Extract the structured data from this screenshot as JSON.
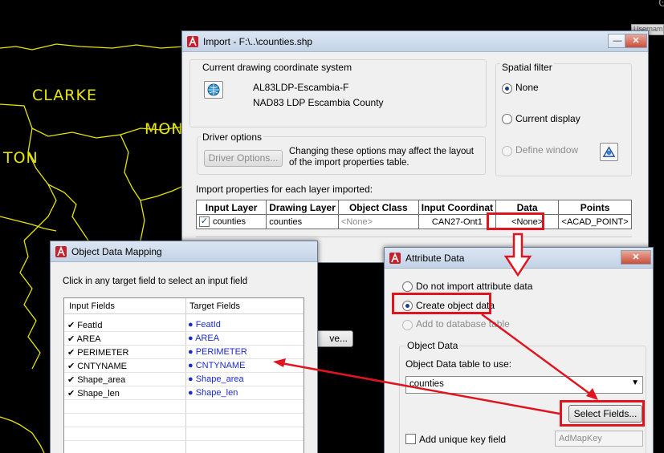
{
  "cad": {
    "labels": [
      "CLARKE",
      "MON",
      "TON"
    ],
    "corner_button": "Username"
  },
  "import_dialog": {
    "title": "Import - F:\\..\\counties.shp",
    "coord_group_label": "Current drawing coordinate system",
    "coord_code": "AL83LDP-Escambia-F",
    "coord_name": "NAD83 LDP Escambia County",
    "driver_group_label": "Driver options",
    "driver_button": "Driver Options...",
    "driver_note_line1": "Changing these options may affect the layout",
    "driver_note_line2": "of the import properties table.",
    "spatial_group_label": "Spatial filter",
    "spatial_none": "None",
    "spatial_current": "Current display",
    "spatial_window": "Define window",
    "import_props_label": "Import properties for each layer imported:",
    "columns": [
      "Input Layer",
      "Drawing Layer",
      "Object Class",
      "Input Coordinat",
      "Data",
      "Points"
    ],
    "row": {
      "input_layer": "counties",
      "drawing_layer": "counties",
      "object_class": "<None>",
      "input_coord": "CAN27-Ont1",
      "data": "<None>",
      "points": "<ACAD_POINT>"
    },
    "partial_button": "ve..."
  },
  "mapping_dialog": {
    "title": "Object Data Mapping",
    "instruction": "Click in any target field to select an input field",
    "col_input": "Input Fields",
    "col_target": "Target Fields",
    "rows": [
      {
        "input": "FeatId",
        "target": "FeatId"
      },
      {
        "input": "AREA",
        "target": "AREA"
      },
      {
        "input": "PERIMETER",
        "target": "PERIMETER"
      },
      {
        "input": "CNTYNAME",
        "target": "CNTYNAME"
      },
      {
        "input": "Shape_area",
        "target": "Shape_area"
      },
      {
        "input": "Shape_len",
        "target": "Shape_len"
      }
    ]
  },
  "attribute_dialog": {
    "title": "Attribute Data",
    "opt_none": "Do not import attribute data",
    "opt_create": "Create object data",
    "opt_db": "Add to database table",
    "object_data_group": "Object Data",
    "table_label": "Object Data table to use:",
    "table_value": "counties",
    "select_fields_button": "Select Fields...",
    "unique_key_label": "Add unique key field",
    "unique_key_value": "AdMapKey"
  },
  "colors": {
    "annotation_red": "#e0141e",
    "cad_yellow": "#e6e600",
    "link_blue": "#1b2ad0"
  }
}
